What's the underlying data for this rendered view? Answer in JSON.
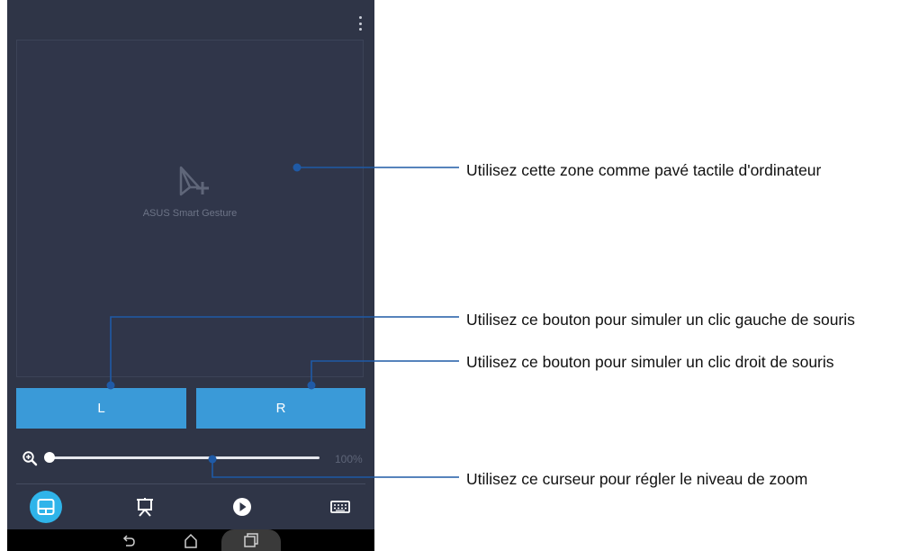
{
  "app": {
    "pad_label": "ASUS Smart Gesture",
    "left_button": "L",
    "right_button": "R",
    "zoom_value": "100%",
    "zoom_level_fraction": 0.0,
    "tabs": [
      {
        "icon": "touchpad-icon",
        "active": true
      },
      {
        "icon": "presentation-icon",
        "active": false
      },
      {
        "icon": "play-icon",
        "active": false
      },
      {
        "icon": "keyboard-icon",
        "active": false
      }
    ],
    "nav": [
      "back-icon",
      "home-icon",
      "recent-apps-icon"
    ],
    "colors": {
      "accent": "#2fb4ea",
      "button": "#3a9ad8",
      "background": "#2f3547",
      "callout_line": "#1f5aa6"
    }
  },
  "callouts": {
    "touchpad": "Utilisez cette zone comme pavé tactile d'ordinateur",
    "left_click": "Utilisez ce bouton pour simuler un clic gauche de souris",
    "right_click": "Utilisez ce bouton pour simuler un clic droit de souris",
    "zoom": "Utilisez ce curseur pour régler le niveau de zoom"
  }
}
